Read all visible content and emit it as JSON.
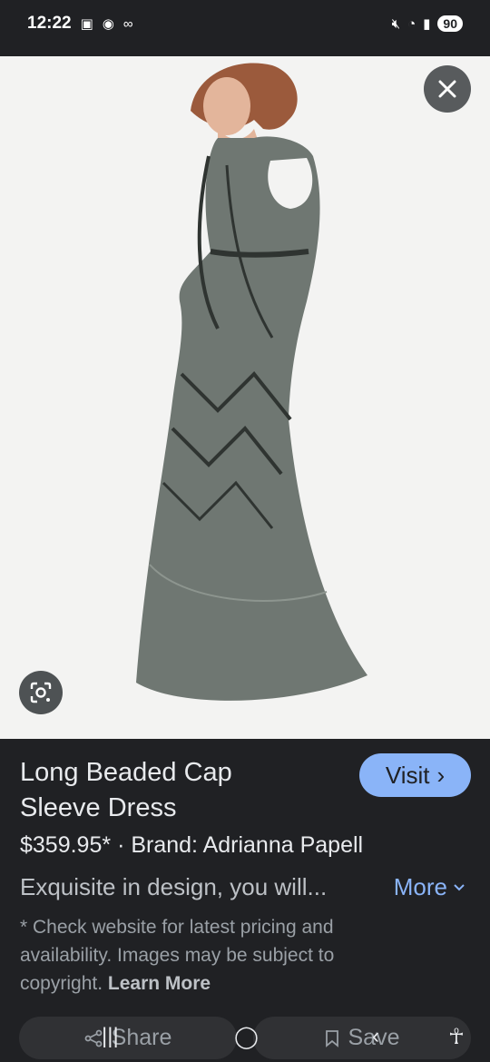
{
  "status_bar": {
    "time": "12:22",
    "battery": "90"
  },
  "product": {
    "title": "Long Beaded Cap Sleeve Dress",
    "price": "$359.95*",
    "brand_label": "Brand: Adrianna Papell",
    "description": "Exquisite in design, you will...",
    "disclaimer": "* Check website for latest pricing and availability. Images may be subject to copyright.",
    "learn_more": "Learn More"
  },
  "actions": {
    "visit": "Visit",
    "more": "More",
    "share": "Share",
    "save": "Save"
  },
  "colors": {
    "background": "#202124",
    "accent": "#8ab4f8",
    "dress": "#6f7772",
    "image_bg": "#f3f3f2"
  }
}
